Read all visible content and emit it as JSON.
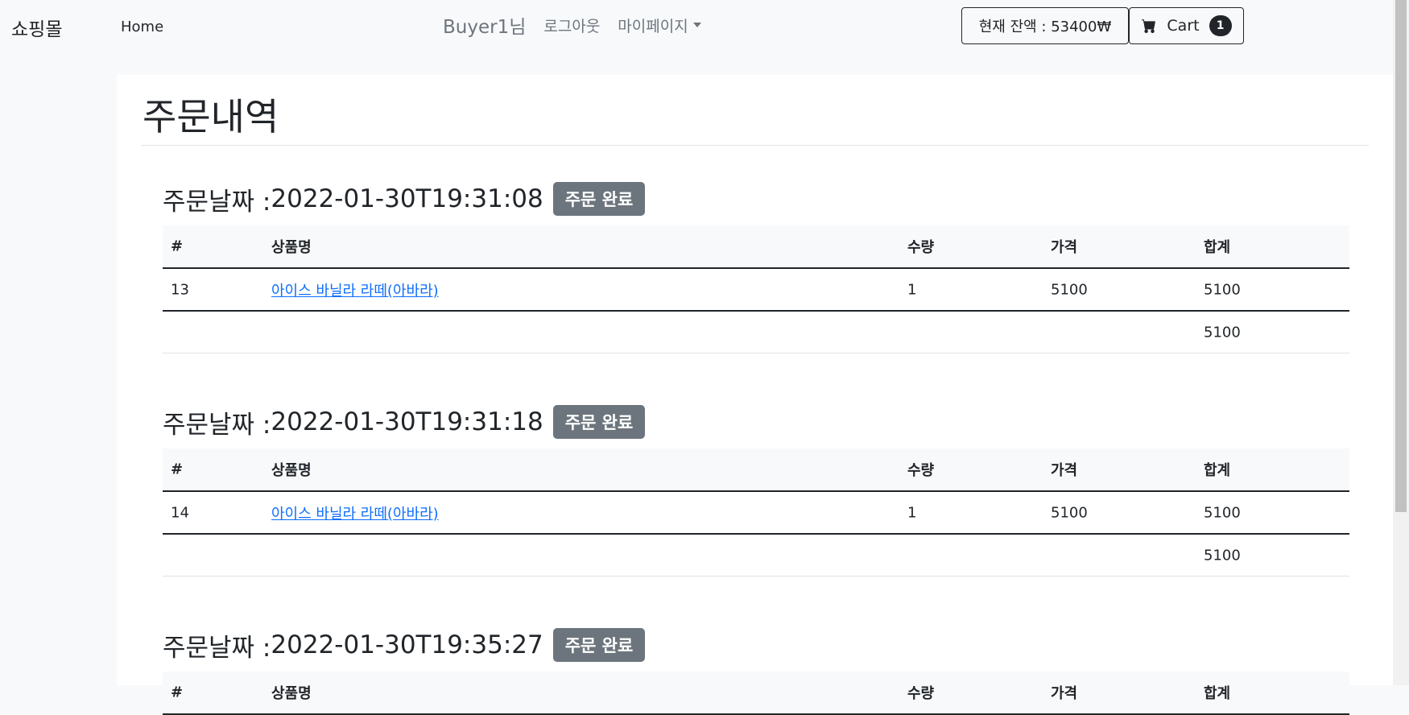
{
  "navbar": {
    "brand": "쇼핑몰",
    "home": "Home",
    "user": "Buyer1님",
    "logout": "로그아웃",
    "mypage": "마이페이지",
    "balance": "현재 잔액 : 53400₩",
    "cart_label": "Cart",
    "cart_count": "1"
  },
  "page": {
    "title": "주문내역"
  },
  "table_headers": [
    "#",
    "상품명",
    "수량",
    "가격",
    "합계"
  ],
  "orders": [
    {
      "date_label": "주문날짜 : ",
      "date": "2022-01-30T19:31:08",
      "status": "주문 완료",
      "items": [
        {
          "id": "13",
          "name": "아이스 바닐라 라떼(아바라)",
          "qty": "1",
          "price": "5100",
          "total": "5100"
        }
      ],
      "sum": "5100"
    },
    {
      "date_label": "주문날짜 : ",
      "date": "2022-01-30T19:31:18",
      "status": "주문 완료",
      "items": [
        {
          "id": "14",
          "name": "아이스 바닐라 라떼(아바라)",
          "qty": "1",
          "price": "5100",
          "total": "5100"
        }
      ],
      "sum": "5100"
    },
    {
      "date_label": "주문날짜 : ",
      "date": "2022-01-30T19:35:27",
      "status": "주문 완료",
      "items": [],
      "sum": ""
    }
  ]
}
